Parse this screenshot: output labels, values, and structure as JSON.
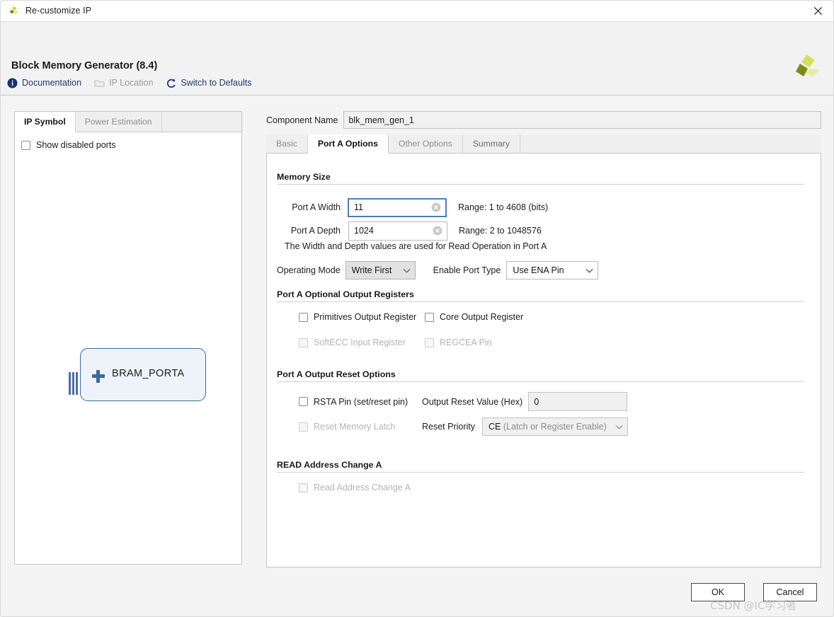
{
  "window": {
    "title": "Re-customize IP",
    "app_icon": "xilinx-logo-icon",
    "close_label": "✕"
  },
  "header": {
    "title": "Block Memory Generator (8.4)",
    "logo": "amd-xilinx-pinwheel-logo",
    "links": [
      {
        "label": "Documentation",
        "icon": "info-circle-icon",
        "enabled": true
      },
      {
        "label": "IP Location",
        "icon": "folder-icon",
        "enabled": false
      },
      {
        "label": "Switch to Defaults",
        "icon": "refresh-icon",
        "enabled": true
      }
    ]
  },
  "left_panel": {
    "tabs": [
      {
        "label": "IP Symbol",
        "active": true
      },
      {
        "label": "Power Estimation",
        "active": false
      }
    ],
    "show_disabled_ports": {
      "label": "Show disabled ports",
      "checked": false
    },
    "symbol": {
      "label": "BRAM_PORTA",
      "expand_icon": "plus-icon",
      "bus_icon": "bus-stub-icon",
      "border_color": "#3b6aa0",
      "fill_color": "#eef2f9"
    }
  },
  "component_name": {
    "label": "Component Name",
    "value": "blk_mem_gen_1"
  },
  "tabs": [
    {
      "label": "Basic",
      "active": false,
      "style": "light"
    },
    {
      "label": "Port A Options",
      "active": true,
      "style": "active"
    },
    {
      "label": "Other Options",
      "active": false,
      "style": "light"
    },
    {
      "label": "Summary",
      "active": false,
      "style": "dark"
    }
  ],
  "sections": {
    "memory_size": {
      "title": "Memory Size",
      "port_a_width": {
        "label": "Port A Width",
        "value": "11",
        "range_text": "Range: 1 to 4608 (bits)",
        "focused": true,
        "clear_icon": "clear-circle-icon"
      },
      "port_a_depth": {
        "label": "Port A Depth",
        "value": "1024",
        "range_text": "Range: 2 to 1048576",
        "focused": false,
        "clear_icon": "clear-circle-icon"
      },
      "note": "The Width and Depth values are used for Read Operation in Port A",
      "operating_mode": {
        "label": "Operating Mode",
        "value": "Write First",
        "state": "gray"
      },
      "enable_port_type": {
        "label": "Enable Port Type",
        "value": "Use ENA Pin",
        "state": "normal"
      }
    },
    "optional_output_registers": {
      "title": "Port A Optional Output Registers",
      "checkboxes": [
        {
          "label": "Primitives Output Register",
          "checked": false,
          "enabled": true
        },
        {
          "label": "Core Output Register",
          "checked": false,
          "enabled": true
        },
        {
          "label": "SoftECC Input Register",
          "checked": false,
          "enabled": false
        },
        {
          "label": "REGCEA Pin",
          "checked": false,
          "enabled": false
        }
      ]
    },
    "output_reset_options": {
      "title": "Port A Output Reset Options",
      "rsta_pin": {
        "label": "RSTA Pin (set/reset pin)",
        "checked": false,
        "enabled": true
      },
      "reset_memory_latch": {
        "label": "Reset Memory Latch",
        "checked": false,
        "enabled": false
      },
      "output_reset_value": {
        "label": "Output Reset Value (Hex)",
        "value": "0",
        "enabled": false
      },
      "reset_priority": {
        "label": "Reset Priority",
        "value_strong": "CE",
        "value_rest": " (Latch or Register Enable)",
        "enabled": false
      }
    },
    "read_address_change": {
      "title": "READ Address Change A",
      "checkbox": {
        "label": "Read Address Change A",
        "checked": false,
        "enabled": false
      }
    }
  },
  "footer": {
    "ok_label": "OK",
    "cancel_label": "Cancel"
  },
  "watermark": "CSDN @IC学习者"
}
